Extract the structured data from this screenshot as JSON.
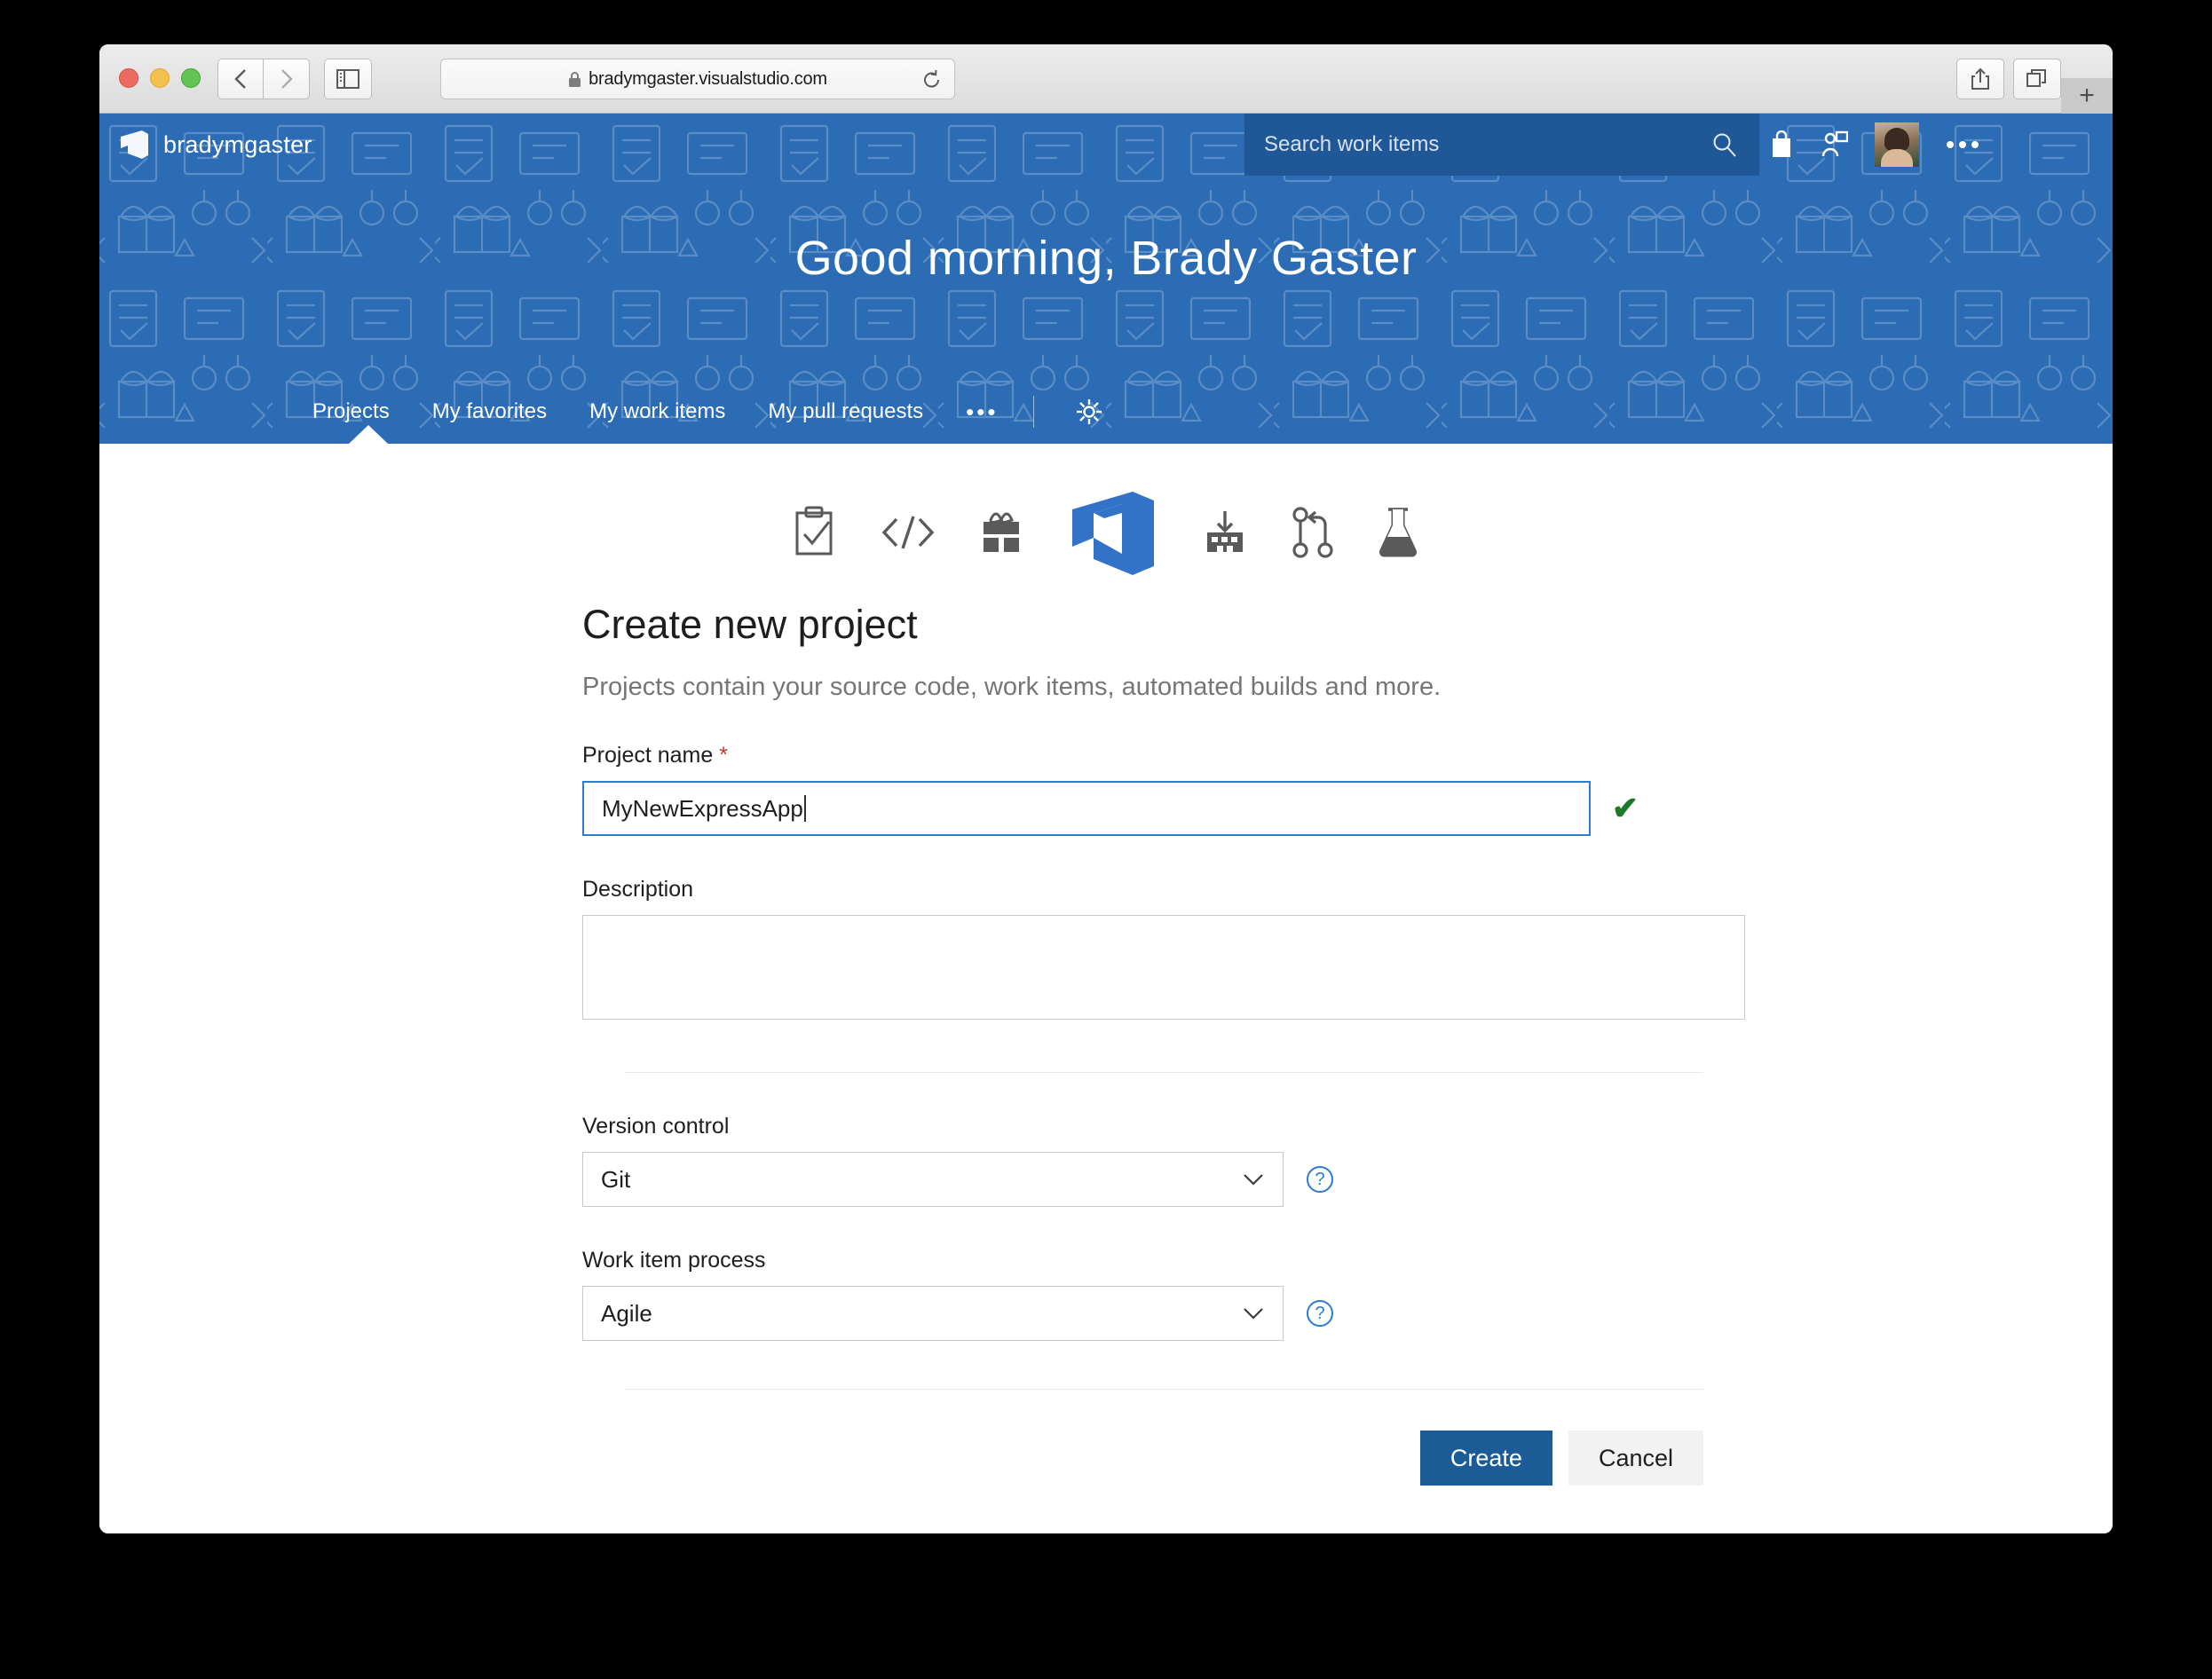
{
  "browser": {
    "url": "bradymgaster.visualstudio.com",
    "lock_icon": "lock-icon",
    "back_icon": "chevron-left-icon",
    "forward_icon": "chevron-right-icon",
    "sidebar_icon": "sidebar-toggle-icon",
    "reload_icon": "reload-icon",
    "share_icon": "share-icon",
    "tabs_icon": "show-all-tabs-icon",
    "newtab_label": "+"
  },
  "header": {
    "org_name": "bradymgaster",
    "logo_icon": "vsts-logo-icon",
    "greeting": "Good morning, Brady Gaster",
    "search": {
      "placeholder": "Search work items",
      "icon": "search-icon"
    },
    "icons": [
      {
        "name": "marketplace-bag-icon"
      },
      {
        "name": "user-feedback-icon"
      },
      {
        "name": "avatar"
      },
      {
        "name": "more-actions-ellipsis-icon"
      }
    ],
    "nav": {
      "items": [
        {
          "label": "Projects",
          "active": true
        },
        {
          "label": "My favorites",
          "active": false
        },
        {
          "label": "My work items",
          "active": false
        },
        {
          "label": "My pull requests",
          "active": false
        }
      ],
      "more_label": "•••",
      "settings_icon": "gear-icon"
    }
  },
  "content": {
    "icon_row": [
      "work-items-clipboard-icon",
      "code-brackets-icon",
      "package-gift-icon",
      "vsts-logo-icon",
      "build-factory-icon",
      "pull-request-branch-icon",
      "test-flask-icon"
    ],
    "title": "Create new project",
    "subtitle": "Projects contain your source code, work items, automated builds and more.",
    "project_name": {
      "label": "Project name",
      "required_mark": "*",
      "value": "MyNewExpressApp",
      "valid_icon": "checkmark-icon"
    },
    "description": {
      "label": "Description",
      "value": "",
      "placeholder": ""
    },
    "version_control": {
      "label": "Version control",
      "value": "Git",
      "chevron": "⌄",
      "help_icon": "help-question-icon",
      "help_label": "?"
    },
    "work_item_process": {
      "label": "Work item process",
      "value": "Agile",
      "chevron": "⌄",
      "help_icon": "help-question-icon",
      "help_label": "?"
    },
    "buttons": {
      "create": "Create",
      "cancel": "Cancel"
    }
  },
  "colors": {
    "header_blue": "#2b6cb5",
    "search_blue": "#1f5797",
    "primary_button": "#1b5c96",
    "focus_border": "#2b7cd3",
    "valid_green": "#1b7a28",
    "required_red": "#c9362c"
  }
}
